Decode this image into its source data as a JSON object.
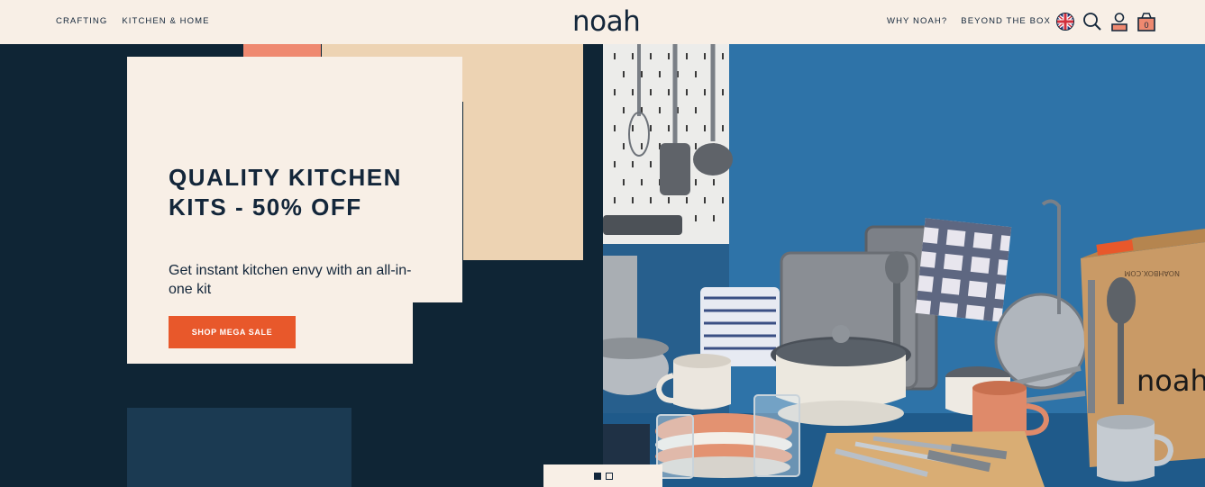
{
  "header": {
    "nav_left": [
      "CRAFTING",
      "KITCHEN & HOME"
    ],
    "logo": "noah",
    "nav_right": [
      "WHY NOAH?",
      "BEYOND THE BOX"
    ],
    "cart_count": "0",
    "icons": [
      "uk-flag-icon",
      "search-icon",
      "account-icon",
      "cart-icon"
    ]
  },
  "hero": {
    "title": "QUALITY KITCHEN KITS - 50% OFF",
    "subtitle": "Get instant kitchen envy with an all-in-one kit",
    "cta": "SHOP MEGA SALE",
    "box_label": "noah",
    "box_url": "NOAHBOX.COM"
  },
  "slider": {
    "count": 2,
    "active": 1
  },
  "colors": {
    "cream": "#f8efe6",
    "navy": "#0f2535",
    "orange": "#e8582b",
    "coral": "#ef8970",
    "peach": "#edd3b3",
    "wall_blue": "#2e73a8"
  }
}
